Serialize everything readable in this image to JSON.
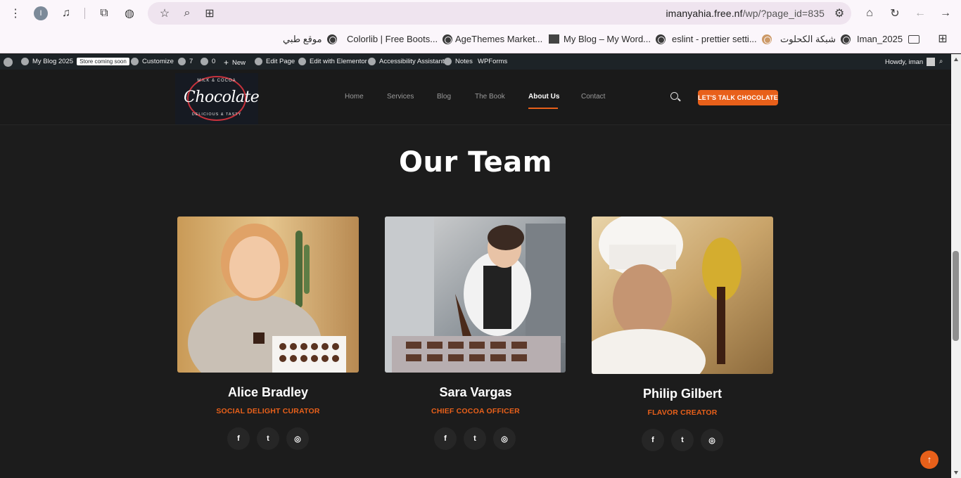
{
  "browser": {
    "url_host": "imanyahia.free.nf",
    "url_path": "/wp/?page_id=835",
    "profile_initial": "I"
  },
  "bookmarks": [
    {
      "label": "موقع طبي"
    },
    {
      "label": "Colorlib | Free Boots..."
    },
    {
      "label": "AgeThemes Market..."
    },
    {
      "label": "My Blog – My Word..."
    },
    {
      "label": "eslint - prettier setti..."
    },
    {
      "label": "شبكة الكحلوت"
    },
    {
      "label": "Iman_2025"
    }
  ],
  "wp_admin_bar": {
    "site_name": "My Blog 2025",
    "store_badge": "Store coming soon",
    "customize": "Customize",
    "updates_count": "7",
    "comments_count": "0",
    "new": "New",
    "edit_page": "Edit Page",
    "edit_elementor": "Edit with Elementor",
    "accessibility": "Accessibility Assistant",
    "notes": "Notes",
    "wpforms": "WPForms",
    "howdy": "Howdy, iman"
  },
  "logo": {
    "text": "Chocolate",
    "top": "MILK & COCOA",
    "bottom": "DELICIOUS & TASTY"
  },
  "nav": {
    "items": [
      {
        "label": "Home"
      },
      {
        "label": "Services"
      },
      {
        "label": "Blog"
      },
      {
        "label": "The Book"
      },
      {
        "label": "About Us"
      },
      {
        "label": "Contact"
      }
    ],
    "active": "About Us",
    "cta": "LET'S TALK CHOCOLATE"
  },
  "team": {
    "title": "Our Team",
    "members": [
      {
        "name": "Alice Bradley",
        "role": "SOCIAL DELIGHT CURATOR"
      },
      {
        "name": "Sara Vargas",
        "role": "CHIEF COCOA OFFICER"
      },
      {
        "name": "Philip Gilbert",
        "role": "FLAVOR CREATOR"
      }
    ],
    "social_icons": [
      "facebook-icon",
      "twitter-icon",
      "instagram-icon"
    ]
  },
  "colors": {
    "accent": "#e8601a",
    "background": "#1c1c1c"
  }
}
